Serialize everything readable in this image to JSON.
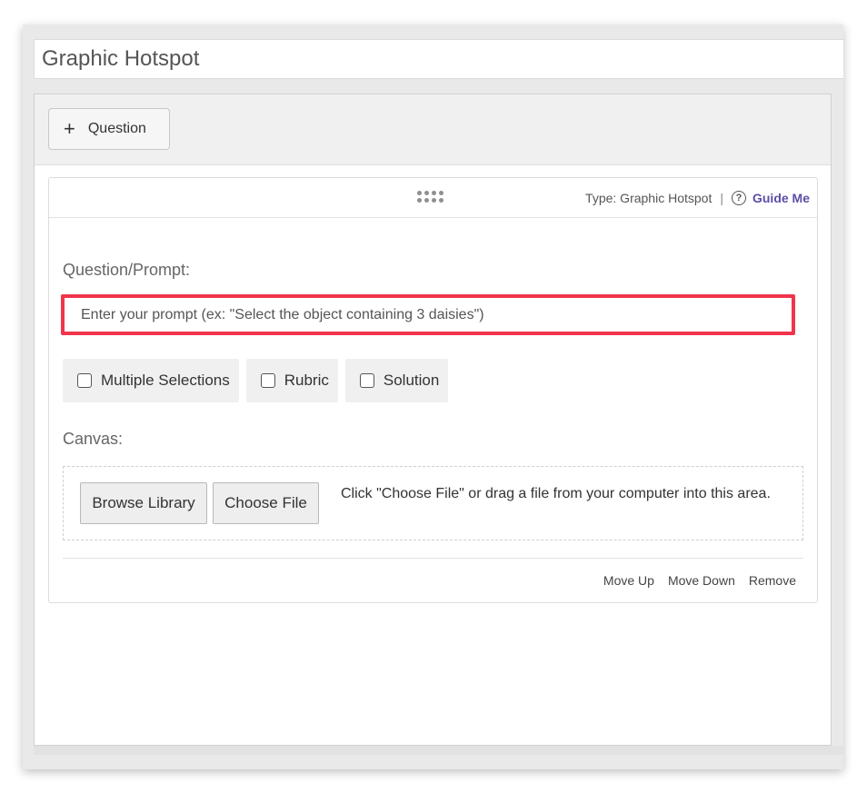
{
  "page": {
    "title": "Graphic Hotspot"
  },
  "toolbar": {
    "add_question_icon": "plus-icon",
    "add_question_label": "Question"
  },
  "card": {
    "drag_icon": "drag-handle-icon",
    "type_label": "Type: Graphic Hotspot",
    "separator": "|",
    "help_icon_glyph": "?",
    "guide_label": "Guide Me",
    "guide_color": "#5b4da7",
    "prompt_label": "Question/Prompt:",
    "prompt_placeholder": "Enter your prompt (ex: \"Select the object containing 3 daisies\")",
    "highlight_color": "#f0354c",
    "options": [
      {
        "label": "Multiple Selections",
        "checked": false
      },
      {
        "label": "Rubric",
        "checked": false
      },
      {
        "label": "Solution",
        "checked": false
      }
    ],
    "canvas_label": "Canvas:",
    "browse_label": "Browse Library",
    "choose_label": "Choose File",
    "drop_hint": "Click \"Choose File\" or drag a file from your computer into this area.",
    "footer": {
      "move_up": "Move Up",
      "move_down": "Move Down",
      "remove": "Remove"
    }
  }
}
